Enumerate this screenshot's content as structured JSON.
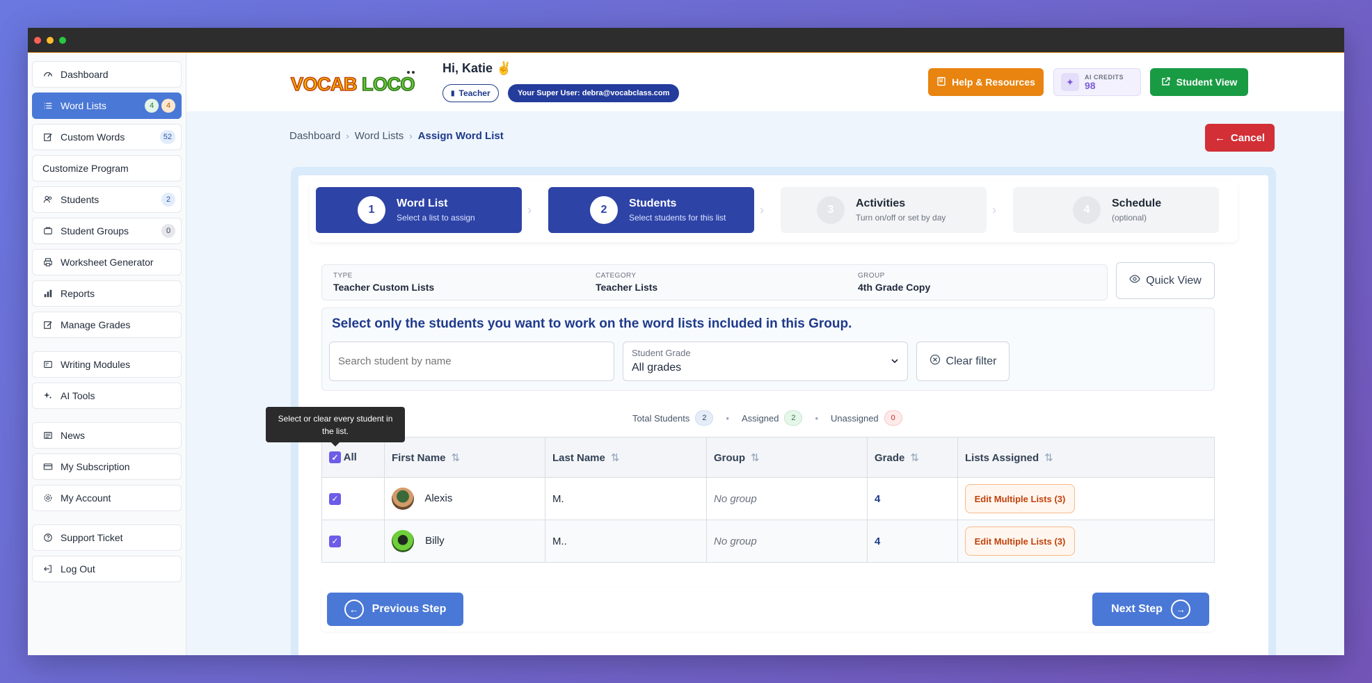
{
  "sidebar": {
    "items": [
      {
        "label": "Dashboard",
        "icon": "gauge-icon"
      },
      {
        "label": "Word Lists",
        "icon": "list-icon",
        "badges": [
          "4",
          "4"
        ]
      },
      {
        "label": "Custom Words",
        "icon": "edit-icon",
        "badges": [
          "52"
        ]
      },
      {
        "label": "Customize Program",
        "icon": "none"
      },
      {
        "label": "Students",
        "icon": "users-icon",
        "badges": [
          "2"
        ]
      },
      {
        "label": "Student Groups",
        "icon": "folder-icon",
        "badges": [
          "0"
        ]
      },
      {
        "label": "Worksheet Generator",
        "icon": "printer-icon"
      },
      {
        "label": "Reports",
        "icon": "bar-chart-icon"
      },
      {
        "label": "Manage Grades",
        "icon": "edit-icon"
      },
      {
        "label": "Writing Modules",
        "icon": "panel-icon"
      },
      {
        "label": "AI Tools",
        "icon": "sparkles-icon"
      },
      {
        "label": "News",
        "icon": "newspaper-icon"
      },
      {
        "label": "My Subscription",
        "icon": "credit-card-icon"
      },
      {
        "label": "My Account",
        "icon": "gear-icon"
      },
      {
        "label": "Support Ticket",
        "icon": "help-circle-icon"
      },
      {
        "label": "Log Out",
        "icon": "logout-icon"
      }
    ]
  },
  "header": {
    "logo_text": "VOCAB LOCO",
    "greeting": "Hi, Katie ✌️",
    "role": "Teacher",
    "super_user_label": "Your Super User:",
    "super_user_email": "debra@vocabclass.com",
    "help_label": "Help & Resources",
    "credits_label": "AI CREDITS",
    "credits_value": "98",
    "student_view_label": "Student View"
  },
  "breadcrumb": [
    "Dashboard",
    "Word Lists",
    "Assign Word List"
  ],
  "cancel_label": "Cancel",
  "steps": [
    {
      "num": "1",
      "title": "Word List",
      "subtitle": "Select a list to assign",
      "state": "done"
    },
    {
      "num": "2",
      "title": "Students",
      "subtitle": "Select students for this list",
      "state": "done"
    },
    {
      "num": "3",
      "title": "Activities",
      "subtitle": "Turn on/off or set by day",
      "state": "off"
    },
    {
      "num": "4",
      "title": "Schedule",
      "subtitle": "(optional)",
      "state": "off"
    }
  ],
  "info": {
    "type_label": "TYPE",
    "type_value": "Teacher Custom Lists",
    "category_label": "CATEGORY",
    "category_value": "Teacher Lists",
    "group_label": "GROUP",
    "group_value": "4th Grade Copy"
  },
  "quick_view_label": "Quick View",
  "filter": {
    "heading": "Select only the students you want to work on the word lists included in this Group.",
    "search_placeholder": "Search student by name",
    "grade_label": "Student Grade",
    "grade_value": "All grades",
    "clear_label": "Clear filter"
  },
  "counts": {
    "total_label": "Total Students",
    "total": "2",
    "assigned_label": "Assigned",
    "assigned": "2",
    "unassigned_label": "Unassigned",
    "unassigned": "0"
  },
  "tooltip": "Select or clear every student in the list.",
  "table": {
    "headers": {
      "all": "All",
      "first": "First Name",
      "last": "Last Name",
      "group": "Group",
      "grade": "Grade",
      "lists": "Lists Assigned"
    },
    "rows": [
      {
        "first": "Alexis",
        "last": "M.",
        "group": "No group",
        "grade": "4",
        "action": "Edit Multiple Lists (3)"
      },
      {
        "first": "Billy",
        "last": "M..",
        "group": "No group",
        "grade": "4",
        "action": "Edit Multiple Lists (3)"
      }
    ]
  },
  "footer": {
    "prev_label": "Previous Step",
    "next_label": "Next Step"
  },
  "colors": {
    "primary": "#4a78d6",
    "step_active": "#2e43a6",
    "help": "#e8840f",
    "student_view": "#199b44",
    "cancel": "#d22f36"
  }
}
